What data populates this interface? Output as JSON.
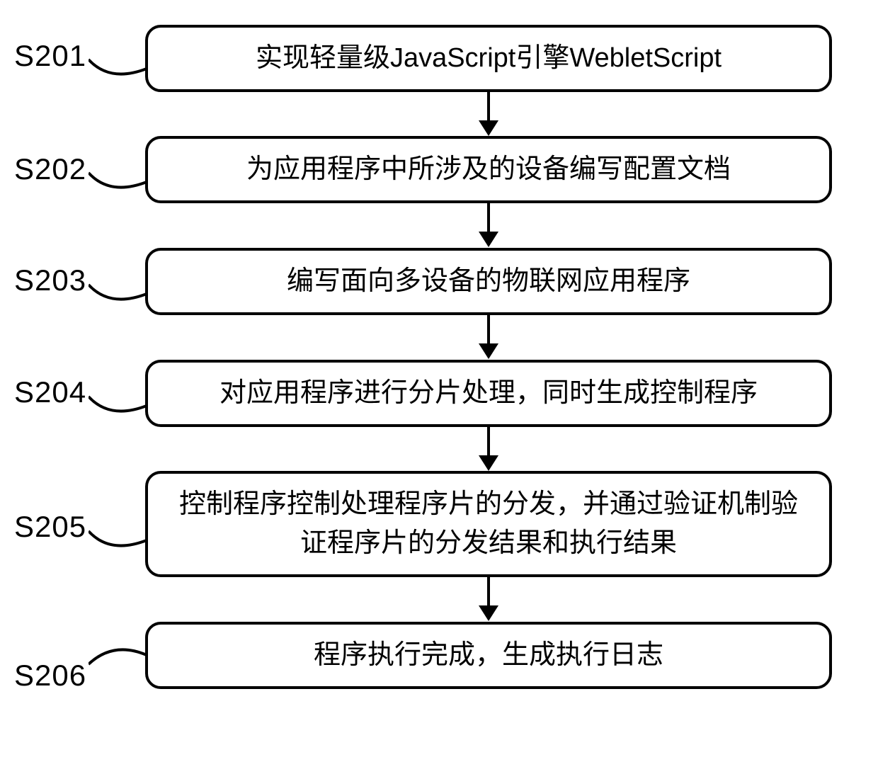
{
  "flow": {
    "steps": [
      {
        "id": "S201",
        "label": "S201",
        "text": "实现轻量级JavaScript引擎WebletScript"
      },
      {
        "id": "S202",
        "label": "S202",
        "text": "为应用程序中所涉及的设备编写配置文档"
      },
      {
        "id": "S203",
        "label": "S203",
        "text": "编写面向多设备的物联网应用程序"
      },
      {
        "id": "S204",
        "label": "S204",
        "text": "对应用程序进行分片处理，同时生成控制程序"
      },
      {
        "id": "S205",
        "label": "S205",
        "text": "控制程序控制处理程序片的分发，并通过验证机制验证程序片的分发结果和执行结果"
      },
      {
        "id": "S206",
        "label": "S206",
        "text": "程序执行完成，生成执行日志"
      }
    ]
  }
}
